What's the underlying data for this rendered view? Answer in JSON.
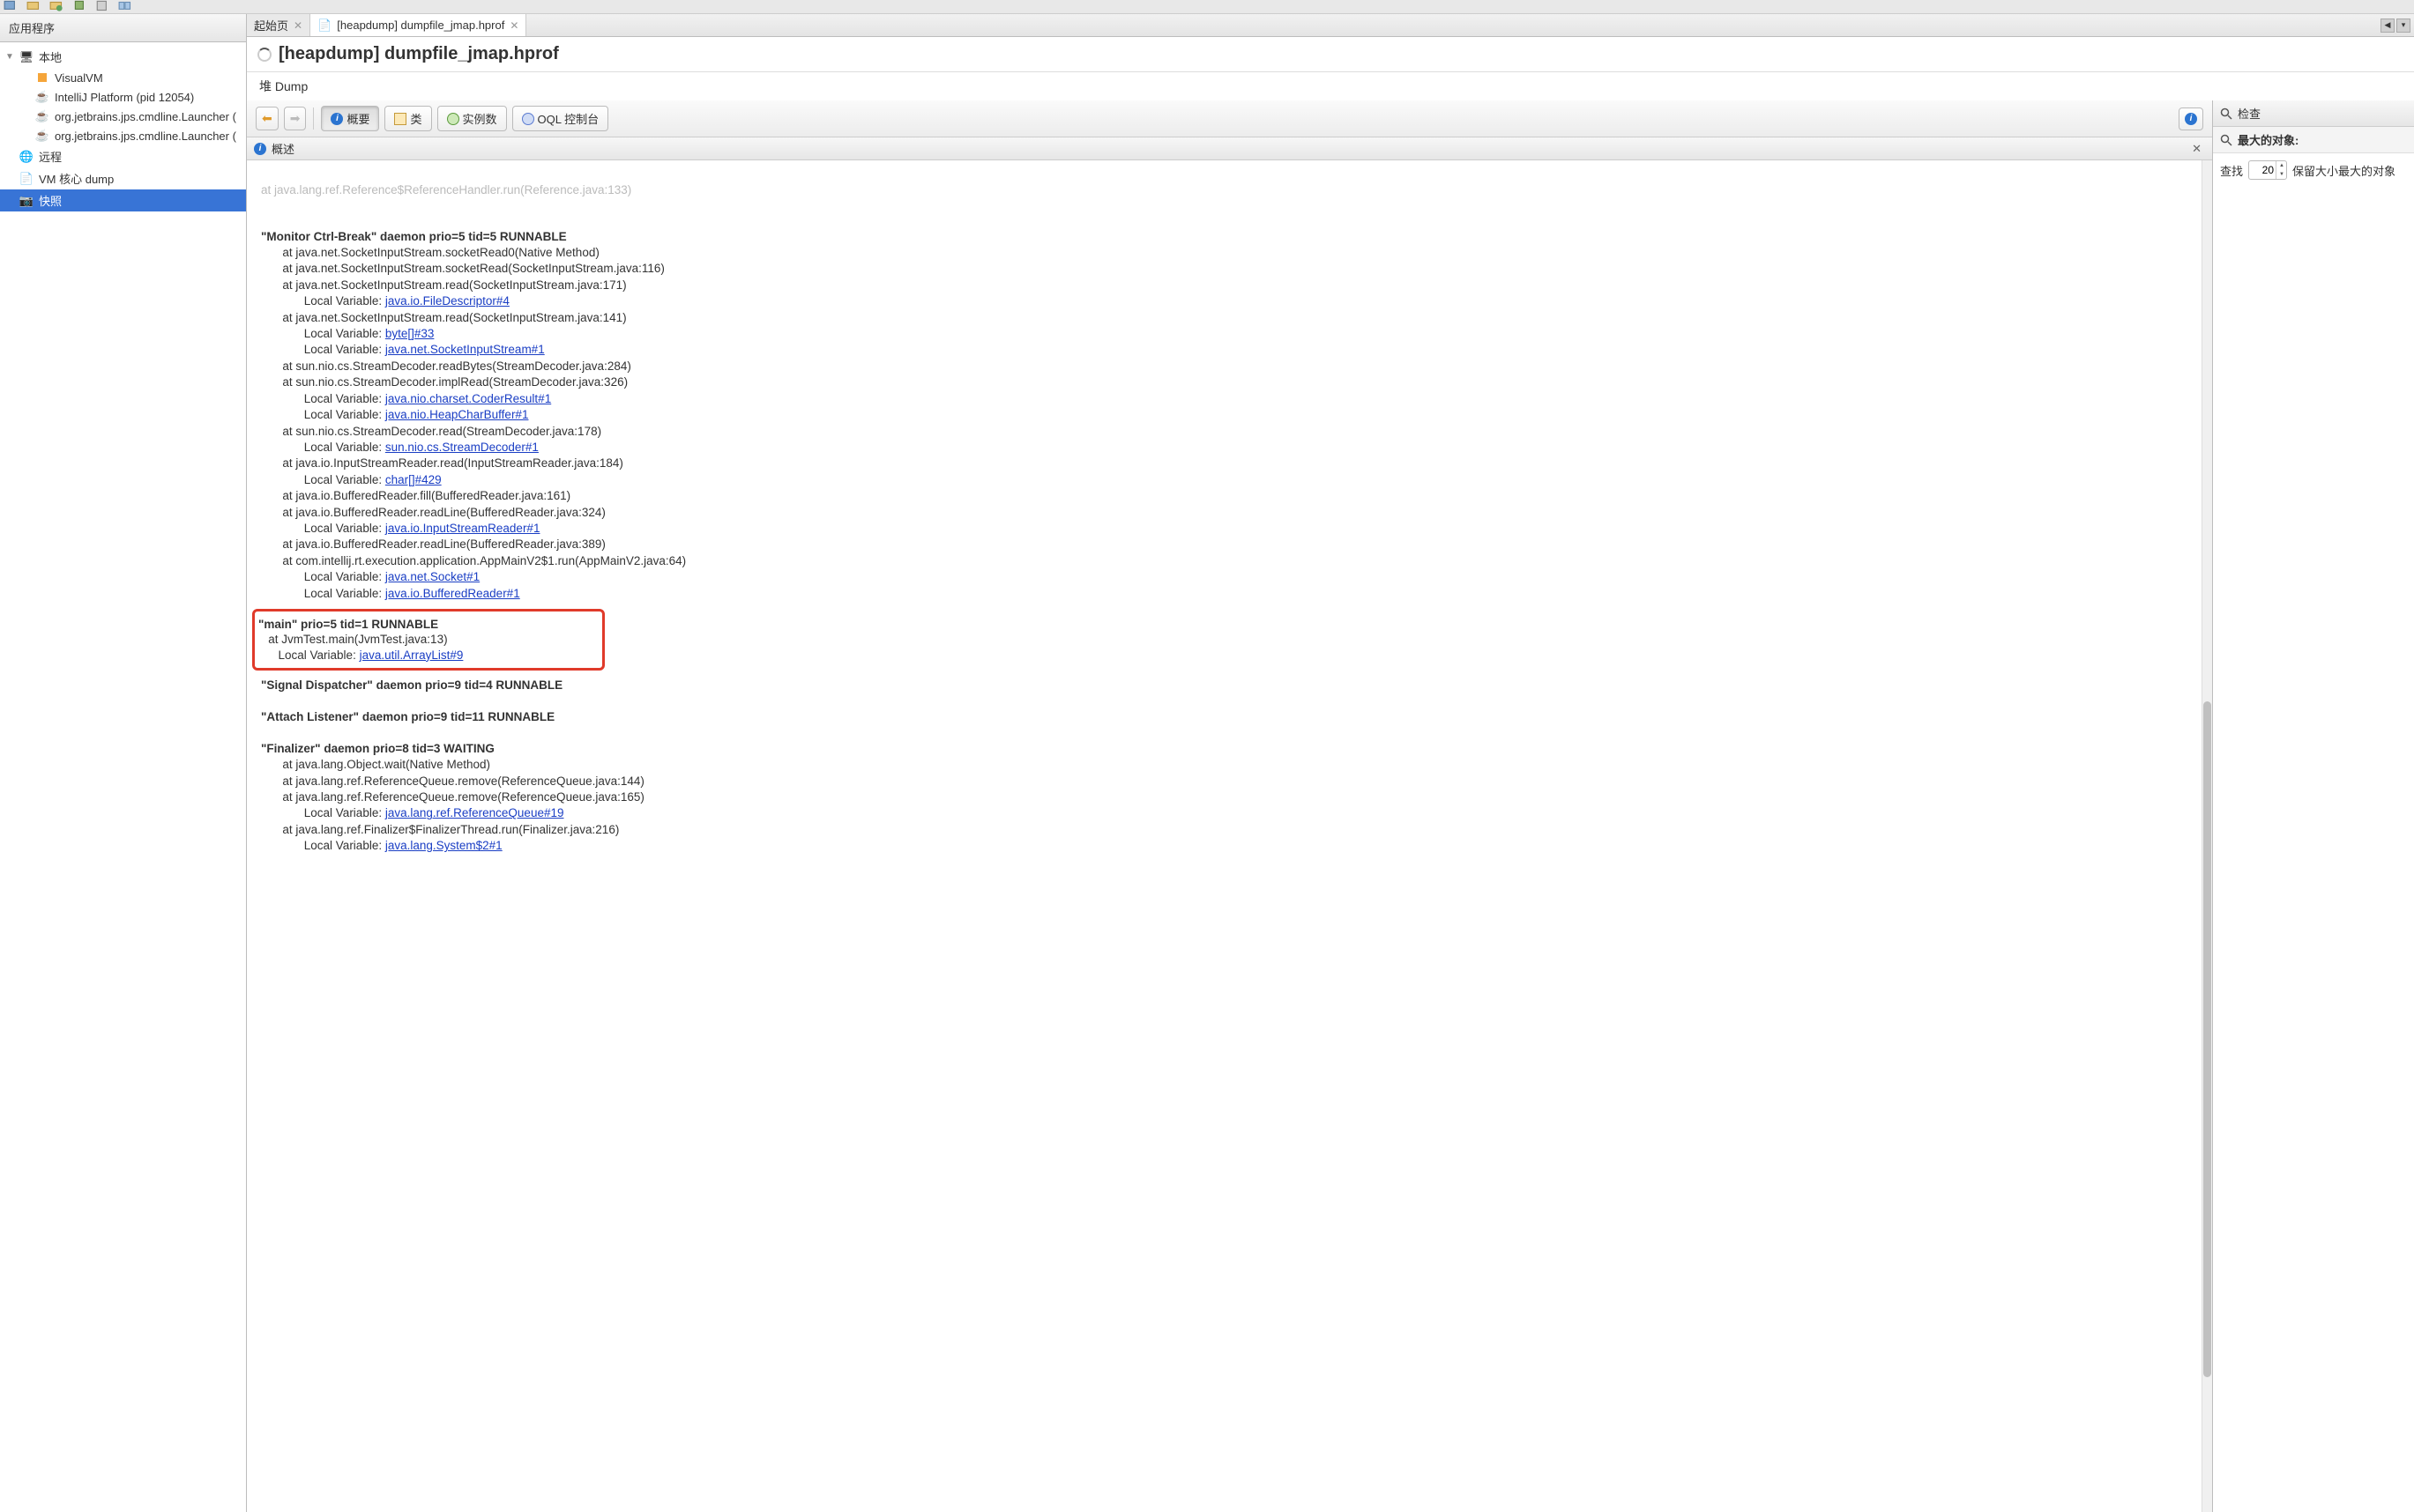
{
  "left_panel": {
    "title": "应用程序",
    "tree": {
      "local_label": "本地",
      "items": [
        "VisualVM",
        "IntelliJ Platform (pid 12054)",
        "org.jetbrains.jps.cmdline.Launcher (",
        "org.jetbrains.jps.cmdline.Launcher ("
      ],
      "remote_label": "远程",
      "vm_core_label": "VM 核心 dump",
      "snapshot_label": "快照"
    }
  },
  "tabs": {
    "start": "起始页",
    "heap": "[heapdump] dumpfile_jmap.hprof"
  },
  "title": "[heapdump] dumpfile_jmap.hprof",
  "subtitle": "堆 Dump",
  "toolbar": {
    "overview": "概要",
    "classes": "类",
    "instances": "实例数",
    "oql": "OQL 控制台"
  },
  "subtab": "概述",
  "inspect": {
    "header": "检查",
    "biggest": "最大的对象:",
    "find": "查找",
    "value": "20",
    "keep": "保留大小最大的对象"
  },
  "dump": {
    "truncated": "at java.lang.ref.Reference$ReferenceHandler.run(Reference.java:133)",
    "thread1_head": "\"Monitor Ctrl-Break\" daemon prio=5 tid=5 RUNNABLE",
    "t1_l1": "at java.net.SocketInputStream.socketRead0(Native Method)",
    "t1_l2": "at java.net.SocketInputStream.socketRead(SocketInputStream.java:116)",
    "t1_l3": "at java.net.SocketInputStream.read(SocketInputStream.java:171)",
    "t1_lv1_p": "Local Variable: ",
    "t1_lv1_a": "java.io.FileDescriptor#4",
    "t1_l4": "at java.net.SocketInputStream.read(SocketInputStream.java:141)",
    "t1_lv2_p": "Local Variable: ",
    "t1_lv2_a": "byte[]#33",
    "t1_lv3_p": "Local Variable: ",
    "t1_lv3_a": "java.net.SocketInputStream#1",
    "t1_l5": "at sun.nio.cs.StreamDecoder.readBytes(StreamDecoder.java:284)",
    "t1_l6": "at sun.nio.cs.StreamDecoder.implRead(StreamDecoder.java:326)",
    "t1_lv4_p": "Local Variable: ",
    "t1_lv4_a": "java.nio.charset.CoderResult#1",
    "t1_lv5_p": "Local Variable: ",
    "t1_lv5_a": "java.nio.HeapCharBuffer#1",
    "t1_l7": "at sun.nio.cs.StreamDecoder.read(StreamDecoder.java:178)",
    "t1_lv6_p": "Local Variable: ",
    "t1_lv6_a": "sun.nio.cs.StreamDecoder#1",
    "t1_l8": "at java.io.InputStreamReader.read(InputStreamReader.java:184)",
    "t1_lv7_p": "Local Variable: ",
    "t1_lv7_a": "char[]#429",
    "t1_l9": "at java.io.BufferedReader.fill(BufferedReader.java:161)",
    "t1_l10": "at java.io.BufferedReader.readLine(BufferedReader.java:324)",
    "t1_lv8_p": "Local Variable: ",
    "t1_lv8_a": "java.io.InputStreamReader#1",
    "t1_l11": "at java.io.BufferedReader.readLine(BufferedReader.java:389)",
    "t1_l12": "at com.intellij.rt.execution.application.AppMainV2$1.run(AppMainV2.java:64)",
    "t1_lv9_p": "Local Variable: ",
    "t1_lv9_a": "java.net.Socket#1",
    "t1_lv10_p": "Local Variable: ",
    "t1_lv10_a": "java.io.BufferedReader#1",
    "main_head": "\"main\" prio=5 tid=1 RUNNABLE",
    "main_l1": "at JvmTest.main(JvmTest.java:13)",
    "main_lv1_p": "Local Variable: ",
    "main_lv1_a": "java.util.ArrayList#9",
    "sig_head": "\"Signal Dispatcher\" daemon prio=9 tid=4 RUNNABLE",
    "att_head": "\"Attach Listener\" daemon prio=9 tid=11 RUNNABLE",
    "fin_head": "\"Finalizer\" daemon prio=8 tid=3 WAITING",
    "fin_l1": "at java.lang.Object.wait(Native Method)",
    "fin_l2": "at java.lang.ref.ReferenceQueue.remove(ReferenceQueue.java:144)",
    "fin_l3": "at java.lang.ref.ReferenceQueue.remove(ReferenceQueue.java:165)",
    "fin_lv1_p": "Local Variable: ",
    "fin_lv1_a": "java.lang.ref.ReferenceQueue#19",
    "fin_l4": "at java.lang.ref.Finalizer$FinalizerThread.run(Finalizer.java:216)",
    "fin_lv2_p": "Local Variable: ",
    "fin_lv2_a": "java.lang.System$2#1"
  }
}
